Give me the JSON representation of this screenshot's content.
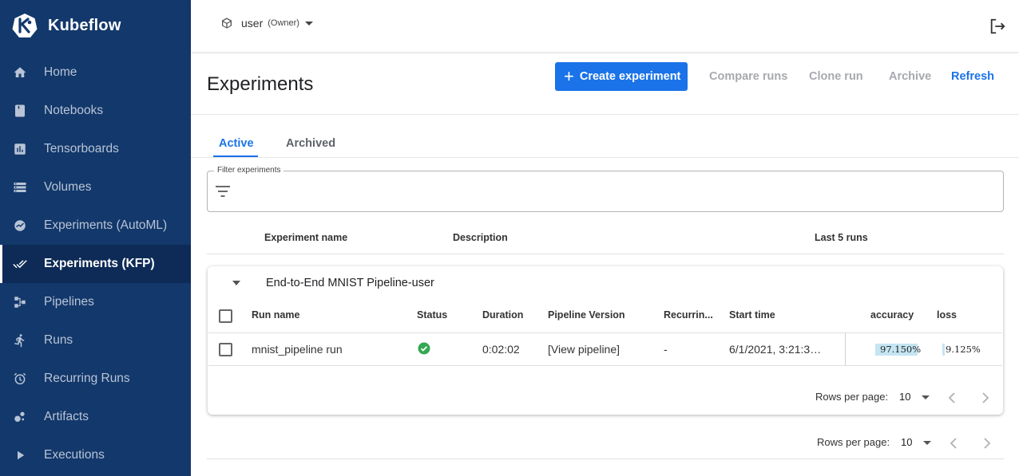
{
  "brand": {
    "name": "Kubeflow"
  },
  "sidebar": {
    "items": [
      {
        "label": "Home",
        "icon": "home-icon"
      },
      {
        "label": "Notebooks",
        "icon": "notebook-icon"
      },
      {
        "label": "Tensorboards",
        "icon": "chart-icon"
      },
      {
        "label": "Volumes",
        "icon": "storage-icon"
      },
      {
        "label": "Experiments (AutoML)",
        "icon": "automl-icon"
      },
      {
        "label": "Experiments (KFP)",
        "icon": "done-all-icon",
        "active": true
      },
      {
        "label": "Pipelines",
        "icon": "pipeline-icon"
      },
      {
        "label": "Runs",
        "icon": "run-icon"
      },
      {
        "label": "Recurring Runs",
        "icon": "alarm-icon"
      },
      {
        "label": "Artifacts",
        "icon": "bubble-icon"
      },
      {
        "label": "Executions",
        "icon": "play-icon"
      }
    ]
  },
  "topbar": {
    "namespace": "user",
    "role": "(Owner)"
  },
  "page": {
    "title": "Experiments"
  },
  "toolbar": {
    "create": "Create experiment",
    "compare": "Compare runs",
    "clone": "Clone run",
    "archive": "Archive",
    "refresh": "Refresh"
  },
  "tabs": {
    "active": "Active",
    "archived": "Archived"
  },
  "filter": {
    "label": "Filter experiments"
  },
  "experiments_table": {
    "columns": {
      "name": "Experiment name",
      "description": "Description",
      "last_runs": "Last 5 runs"
    }
  },
  "experiment": {
    "name": "End-to-End MNIST Pipeline-user",
    "run_columns": {
      "name": "Run name",
      "status": "Status",
      "duration": "Duration",
      "pipeline_version": "Pipeline Version",
      "recurring": "Recurrin...",
      "start_time": "Start time",
      "accuracy": "accuracy",
      "loss": "loss"
    },
    "runs": [
      {
        "name": "mnist_pipeline run",
        "status": "succeeded",
        "duration": "0:02:02",
        "pipeline_version": "[View pipeline]",
        "recurring": "-",
        "start_time": "6/1/2021, 3:21:3…",
        "accuracy": "97.150%",
        "accuracy_value": 97.15,
        "loss": "9.125%",
        "loss_value": 9.125
      }
    ],
    "pager": {
      "label": "Rows per page:",
      "value": "10"
    }
  },
  "pager": {
    "label": "Rows per page:",
    "value": "10"
  },
  "colors": {
    "sidebar_bg": "#13386b",
    "accent": "#1a73e8",
    "success": "#34a853",
    "metric_bar": "#c5e5f2"
  }
}
